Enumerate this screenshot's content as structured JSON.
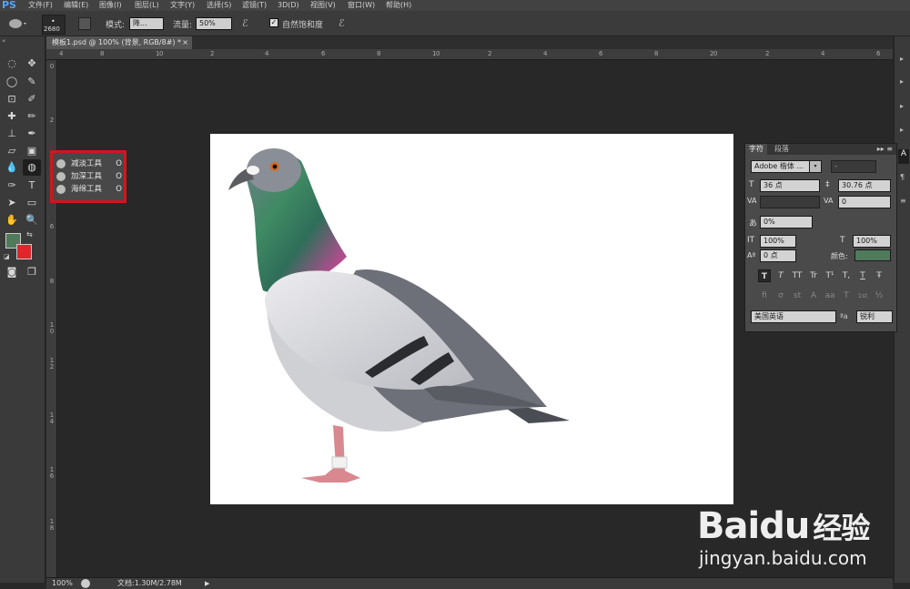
{
  "app": {
    "logo": "PS"
  },
  "menu": [
    "文件(F)",
    "编辑(E)",
    "图像(I)",
    "图层(L)",
    "文字(Y)",
    "选择(S)",
    "滤镜(T)",
    "3D(D)",
    "视图(V)",
    "窗口(W)",
    "帮助(H)"
  ],
  "options": {
    "brush_size": "2680",
    "mode_label": "模式:",
    "mode_value": "降...",
    "flow_label": "流量:",
    "flow_value": "50%",
    "vibrance_label": "自然饱和度",
    "vibrance_checked": true
  },
  "document": {
    "tab_title": "模板1.psd @ 100% (背景, RGB/8#) *",
    "close_glyph": "×",
    "zoom": "100%",
    "doc_info": "文档:1.30M/2.78M"
  },
  "rulers": {
    "top": [
      "4",
      "8",
      "1",
      "0",
      "2",
      "4",
      "6",
      "8",
      "1",
      "0",
      "2",
      "4",
      "6",
      "8",
      "2",
      "0",
      "2",
      "4",
      "6",
      "8",
      "3",
      "0",
      "2",
      "4"
    ],
    "left": [
      "0",
      "2",
      "4",
      "6",
      "8",
      "1 0",
      "1 2",
      "1 4",
      "1 6",
      "1 8",
      "2 0",
      "2 2",
      "2 4",
      "2 6",
      "2 8",
      "3 0"
    ]
  },
  "flyout": {
    "items": [
      {
        "label": "减淡工具",
        "key": "O",
        "icon": "dodge-icon"
      },
      {
        "label": "加深工具",
        "key": "O",
        "icon": "burn-icon"
      },
      {
        "label": "海绵工具",
        "key": "O",
        "icon": "sponge-icon"
      }
    ]
  },
  "character_panel": {
    "tabs": [
      "字符",
      "段落"
    ],
    "font_family": "Adobe 楷体 ...",
    "font_style": "-",
    "font_size": "36 点",
    "leading": "30.76 点",
    "kerning": "",
    "tracking": "0",
    "scale_percent": "0%",
    "vertical_scale": "100%",
    "horizontal_scale": "100%",
    "baseline_shift": "0 点",
    "color_label": "颜色:",
    "color_value": "#4f7a5c",
    "format_row1": [
      "T",
      "T",
      "TT",
      "Tr",
      "T¹",
      "T,",
      "T",
      "Ŧ"
    ],
    "format_row2": [
      "fi",
      "σ",
      "st",
      "A",
      "aa",
      "T",
      "1st",
      "½"
    ],
    "language": "美国英语",
    "aa_label": "ªa",
    "antialias": "锐利"
  },
  "colors": {
    "foreground": "#4f7a5c",
    "background": "#e0262b"
  },
  "watermark": {
    "brand": "Bai",
    "paw": "du",
    "cn": "经验",
    "url": "jingyan.baidu.com"
  }
}
